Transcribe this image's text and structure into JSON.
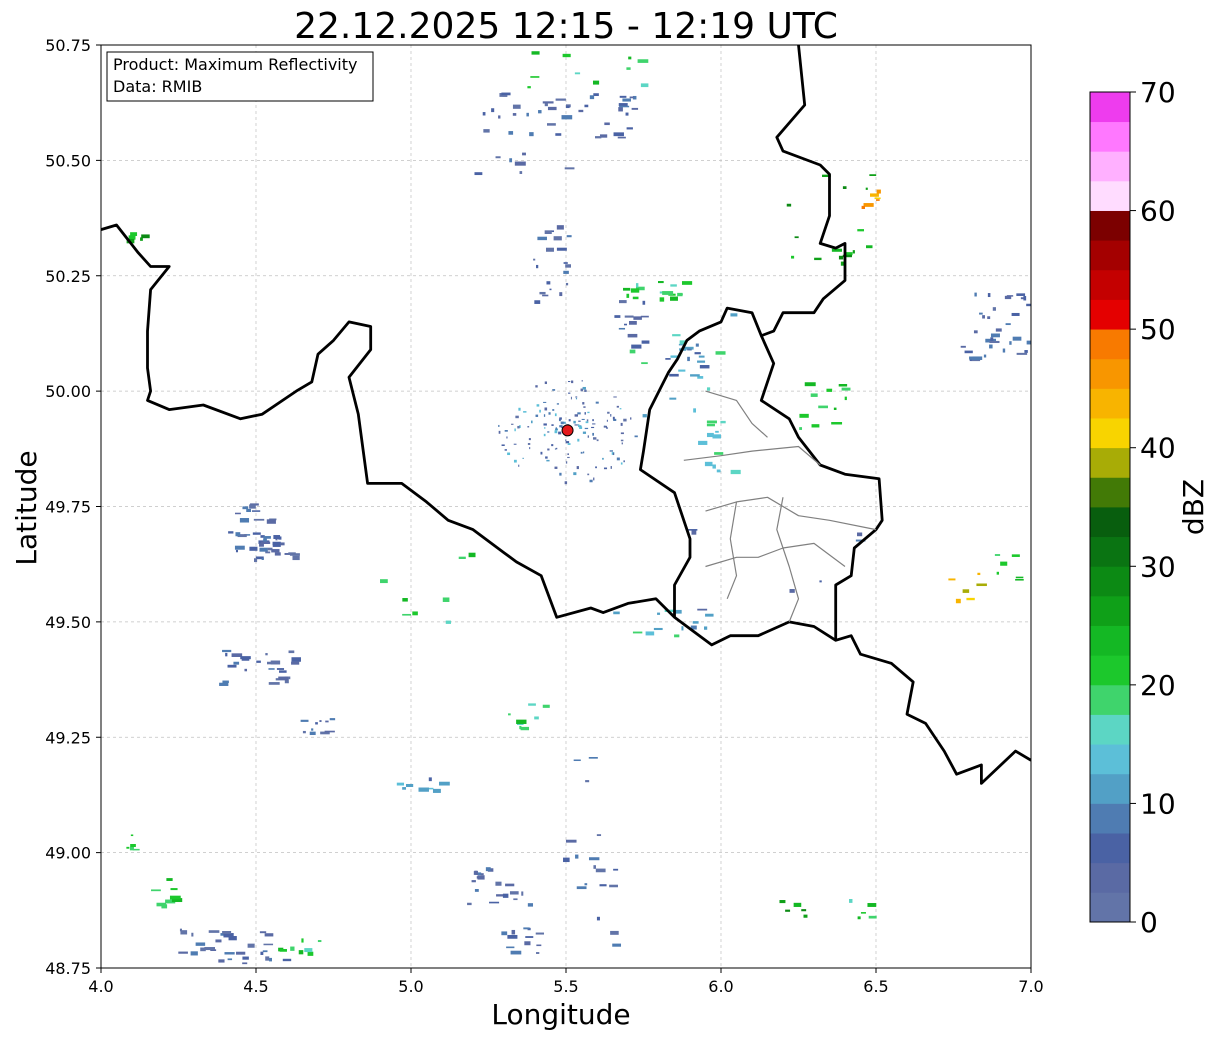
{
  "chart_data": {
    "type": "heatmap",
    "title": "22.12.2025 12:15 - 12:19 UTC",
    "xlabel": "Longitude",
    "ylabel": "Latitude",
    "xlim": [
      4.0,
      7.0
    ],
    "ylim": [
      48.75,
      50.75
    ],
    "x_ticks": [
      "4.0",
      "4.5",
      "5.0",
      "5.5",
      "6.0",
      "6.5",
      "7.0"
    ],
    "y_ticks": [
      "48.75",
      "49.00",
      "49.25",
      "49.50",
      "49.75",
      "50.00",
      "50.25",
      "50.50",
      "50.75"
    ],
    "grid": true,
    "annotation": {
      "product": "Product: Maximum Reflectivity",
      "data": "Data: RMIB",
      "placement": "top-left"
    },
    "radar_site": {
      "lon": 5.505,
      "lat": 49.915,
      "color": "#e41a1c"
    },
    "colorbar": {
      "label": "dBZ",
      "min": 0,
      "max": 70,
      "step": 2.5,
      "ticks": [
        "0",
        "10",
        "20",
        "30",
        "40",
        "50",
        "60",
        "70"
      ],
      "colors": [
        "#6274a8",
        "#5a6aa4",
        "#4a62a4",
        "#4f7cb2",
        "#52a0c6",
        "#5cbfd8",
        "#5cd6c4",
        "#3fd46c",
        "#1cc82c",
        "#14b824",
        "#0fa018",
        "#0c8a14",
        "#0a7412",
        "#085e0e",
        "#427a06",
        "#a8ac06",
        "#f8d400",
        "#f8b400",
        "#f89600",
        "#f87a00",
        "#e40000",
        "#c40000",
        "#a40000",
        "#7c0000",
        "#ffdcff",
        "#ffb0ff",
        "#ff78ff",
        "#ee3cee"
      ]
    },
    "echoes": [
      {
        "lon": 4.48,
        "lat": 49.7,
        "dbz": 5,
        "n": 24,
        "sx": 0.09,
        "sy": 0.06
      },
      {
        "lon": 4.55,
        "lat": 49.66,
        "dbz": 5,
        "n": 18,
        "sx": 0.07,
        "sy": 0.03
      },
      {
        "lon": 4.5,
        "lat": 49.4,
        "dbz": 5,
        "n": 26,
        "sx": 0.12,
        "sy": 0.04
      },
      {
        "lon": 4.68,
        "lat": 49.28,
        "dbz": 5,
        "n": 10,
        "sx": 0.06,
        "sy": 0.02
      },
      {
        "lon": 4.42,
        "lat": 48.8,
        "dbz": 5,
        "n": 30,
        "sx": 0.18,
        "sy": 0.04
      },
      {
        "lon": 4.62,
        "lat": 48.8,
        "dbz": 20,
        "n": 8,
        "sx": 0.08,
        "sy": 0.02
      },
      {
        "lon": 5.5,
        "lat": 50.6,
        "dbz": 5,
        "n": 34,
        "sx": 0.22,
        "sy": 0.05
      },
      {
        "lon": 5.45,
        "lat": 50.28,
        "dbz": 5,
        "n": 20,
        "sx": 0.06,
        "sy": 0.1
      },
      {
        "lon": 5.78,
        "lat": 50.22,
        "dbz": 20,
        "n": 16,
        "sx": 0.1,
        "sy": 0.02
      },
      {
        "lon": 5.7,
        "lat": 50.15,
        "dbz": 5,
        "n": 12,
        "sx": 0.05,
        "sy": 0.05
      },
      {
        "lon": 5.88,
        "lat": 50.07,
        "dbz": 10,
        "n": 16,
        "sx": 0.06,
        "sy": 0.04
      },
      {
        "lon": 5.98,
        "lat": 49.88,
        "dbz": 15,
        "n": 12,
        "sx": 0.06,
        "sy": 0.06
      },
      {
        "lon": 6.35,
        "lat": 50.38,
        "dbz": 25,
        "n": 16,
        "sx": 0.14,
        "sy": 0.1
      },
      {
        "lon": 6.48,
        "lat": 50.42,
        "dbz": 45,
        "n": 6,
        "sx": 0.03,
        "sy": 0.02
      },
      {
        "lon": 6.88,
        "lat": 50.15,
        "dbz": 5,
        "n": 34,
        "sx": 0.11,
        "sy": 0.08
      },
      {
        "lon": 6.3,
        "lat": 49.98,
        "dbz": 20,
        "n": 12,
        "sx": 0.1,
        "sy": 0.06
      },
      {
        "lon": 5.28,
        "lat": 48.93,
        "dbz": 5,
        "n": 20,
        "sx": 0.1,
        "sy": 0.04
      },
      {
        "lon": 5.35,
        "lat": 48.81,
        "dbz": 5,
        "n": 12,
        "sx": 0.06,
        "sy": 0.03
      },
      {
        "lon": 5.8,
        "lat": 49.5,
        "dbz": 15,
        "n": 12,
        "sx": 0.16,
        "sy": 0.03
      },
      {
        "lon": 6.78,
        "lat": 49.58,
        "dbz": 40,
        "n": 6,
        "sx": 0.05,
        "sy": 0.04
      },
      {
        "lon": 6.92,
        "lat": 49.62,
        "dbz": 20,
        "n": 6,
        "sx": 0.04,
        "sy": 0.03
      },
      {
        "lon": 5.38,
        "lat": 49.3,
        "dbz": 20,
        "n": 8,
        "sx": 0.1,
        "sy": 0.03
      },
      {
        "lon": 5.02,
        "lat": 49.15,
        "dbz": 10,
        "n": 8,
        "sx": 0.08,
        "sy": 0.02
      },
      {
        "lon": 4.2,
        "lat": 48.92,
        "dbz": 20,
        "n": 8,
        "sx": 0.04,
        "sy": 0.04
      },
      {
        "lon": 4.08,
        "lat": 49.02,
        "dbz": 20,
        "n": 5,
        "sx": 0.03,
        "sy": 0.03
      },
      {
        "lon": 5.3,
        "lat": 50.55,
        "dbz": 5,
        "n": 14,
        "sx": 0.2,
        "sy": 0.08
      },
      {
        "lon": 5.9,
        "lat": 50.05,
        "dbz": 15,
        "n": 10,
        "sx": 0.2,
        "sy": 0.16
      },
      {
        "lon": 6.15,
        "lat": 49.6,
        "dbz": 5,
        "n": 8,
        "sx": 0.3,
        "sy": 0.14
      },
      {
        "lon": 5.1,
        "lat": 49.6,
        "dbz": 20,
        "n": 8,
        "sx": 0.2,
        "sy": 0.1
      },
      {
        "lon": 4.1,
        "lat": 50.33,
        "dbz": 25,
        "n": 5,
        "sx": 0.03,
        "sy": 0.02
      },
      {
        "lon": 5.55,
        "lat": 49.1,
        "dbz": 5,
        "n": 10,
        "sx": 0.06,
        "sy": 0.2
      },
      {
        "lon": 5.58,
        "lat": 48.9,
        "dbz": 5,
        "n": 8,
        "sx": 0.08,
        "sy": 0.1
      },
      {
        "lon": 6.22,
        "lat": 48.88,
        "dbz": 25,
        "n": 5,
        "sx": 0.05,
        "sy": 0.02
      },
      {
        "lon": 6.45,
        "lat": 48.88,
        "dbz": 20,
        "n": 5,
        "sx": 0.04,
        "sy": 0.02
      },
      {
        "lon": 5.55,
        "lat": 50.7,
        "dbz": 20,
        "n": 10,
        "sx": 0.2,
        "sy": 0.04
      }
    ]
  }
}
